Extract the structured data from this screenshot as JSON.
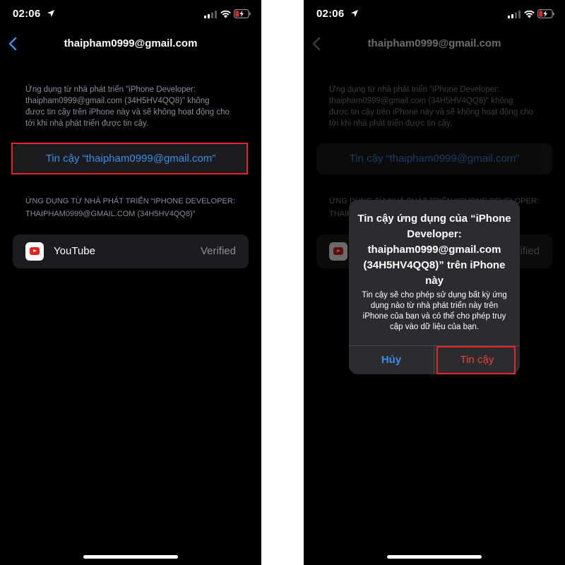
{
  "status_bar": {
    "time": "02:06"
  },
  "nav": {
    "title": "thaipham0999@gmail.com"
  },
  "description": "Ứng dụng từ nhà phát triển \"iPhone Developer: thaipham0999@gmail.com (34H5HV4QQ8)\" không được tin cậy trên iPhone này và sẽ không hoạt động cho tới khi nhà phát triển được tin cậy.",
  "trust_button": {
    "label": "Tin cậy “thaipham0999@gmail.com”"
  },
  "section_header": "ỨNG DỤNG TỪ NHÀ PHÁT TRIỂN “IPHONE DEVELOPER: THAIPHAM0999@GMAIL.COM (34H5HV4QQ8)”",
  "apps": [
    {
      "name": "YouTube",
      "status": "Verified",
      "icon": "youtube-icon"
    }
  ],
  "alert": {
    "title": "Tin cậy ứng dụng của “iPhone Developer: thaipham0999@gmail.com (34H5HV4QQ8)” trên iPhone này",
    "message": "Tin cậy sẽ cho phép sử dụng bất kỳ ứng dụng nào từ nhà phát triển này trên iPhone của bạn và có thể cho phép truy cập vào dữ liệu của bạn.",
    "cancel_label": "Hủy",
    "trust_label": "Tin cậy"
  },
  "colors": {
    "background": "#000000",
    "accent_blue": "#3a8dea",
    "destructive_red": "#e8453c",
    "highlight_red": "#e8222b",
    "secondary_text": "#8e8e93",
    "cell_background": "#1c1c1e",
    "alert_background": "#2c2c2e"
  }
}
